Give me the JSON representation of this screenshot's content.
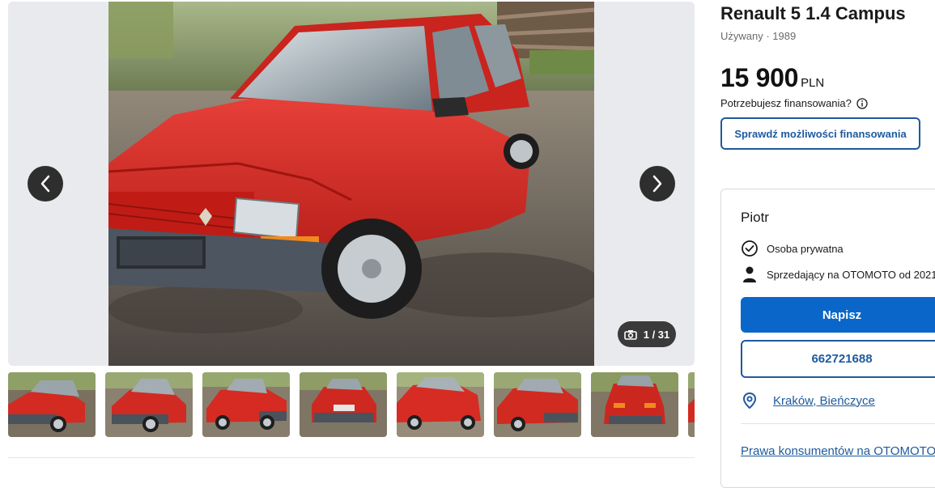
{
  "gallery": {
    "counter": "1 / 31",
    "prev_icon": "chevron-left-icon",
    "next_icon": "chevron-right-icon",
    "camera_icon": "camera-icon",
    "thumbnail_count_visible": 8
  },
  "listing": {
    "title": "Renault 5 1.4 Campus",
    "subtitle": "Używany · 1989",
    "price_amount": "15 900",
    "price_currency": "PLN",
    "finance_question": "Potrzebujesz finansowania?",
    "finance_button": "Sprawdź możliwości finansowania"
  },
  "seller": {
    "name": "Piotr",
    "type": "Osoba prywatna",
    "since": "Sprzedający na OTOMOTO od 2021",
    "write_button": "Napisz",
    "phone": "662721688",
    "location": "Kraków, Bieńczyce",
    "consumer_rights_link": "Prawa konsumentów na OTOMOTO"
  },
  "colors": {
    "accent": "#0a66c8",
    "link": "#1d5a9e",
    "car_red": "#d42a22"
  }
}
